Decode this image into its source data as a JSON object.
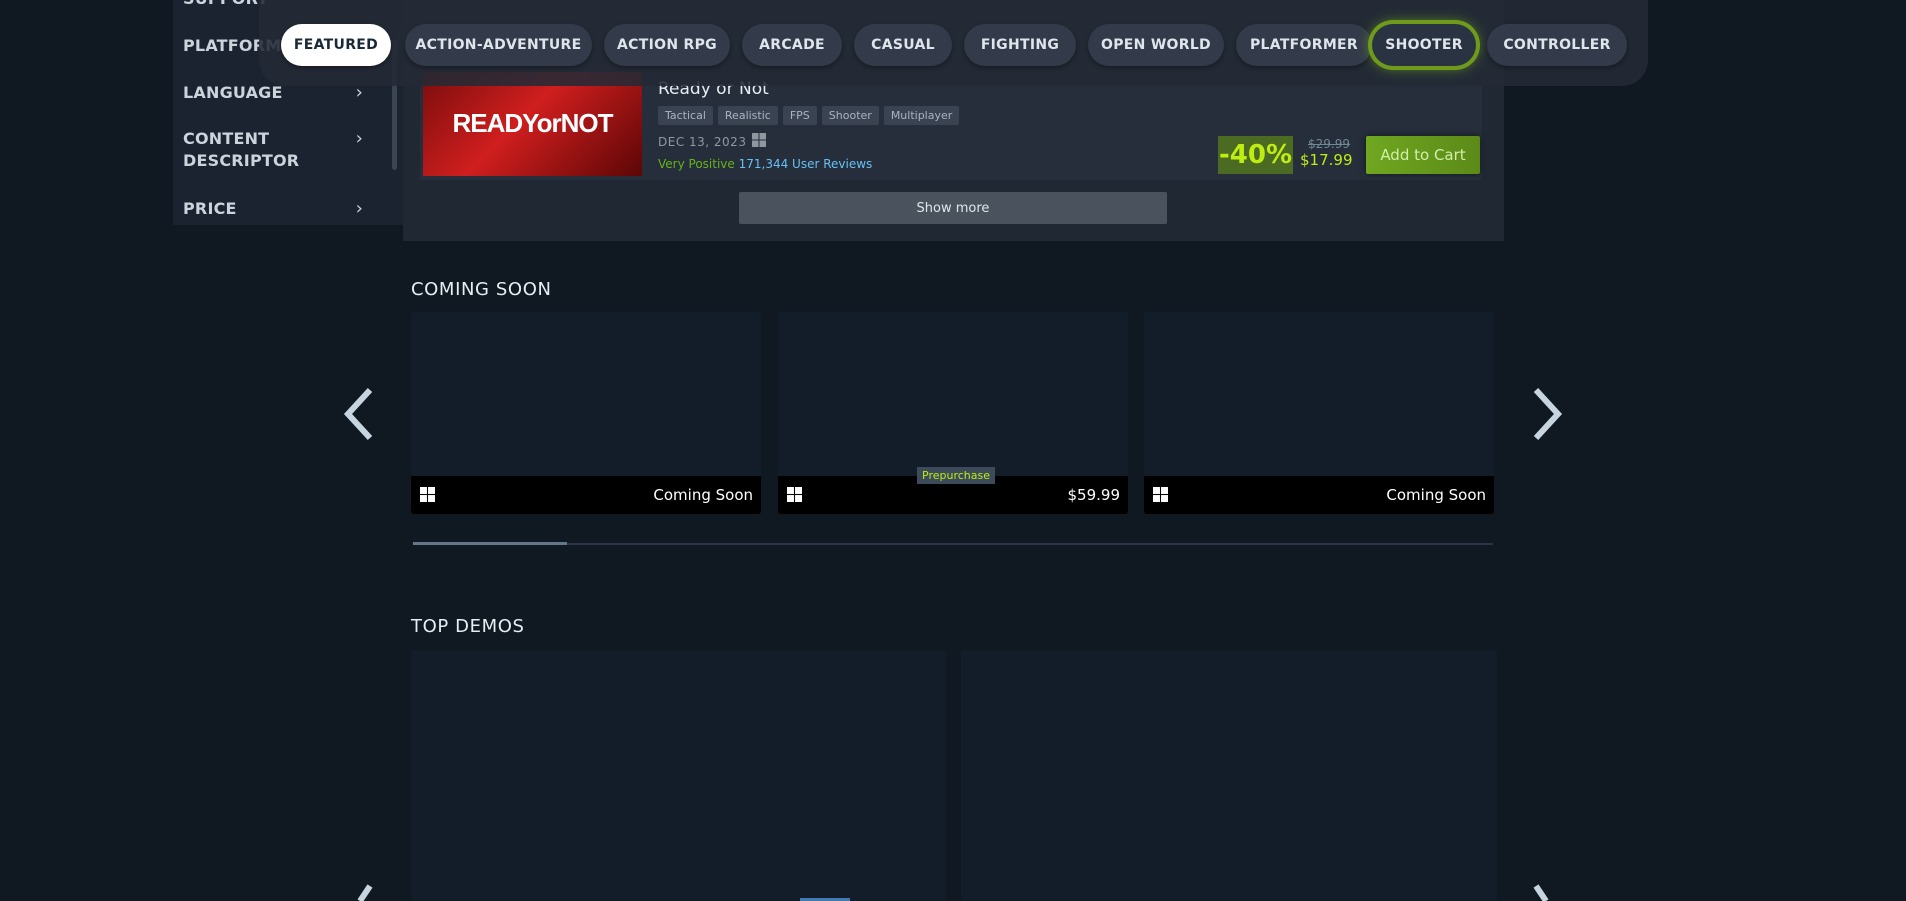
{
  "sidebar": {
    "items": [
      {
        "label": "SUPPORT"
      },
      {
        "label": "PLATFORM"
      },
      {
        "label": "LANGUAGE"
      },
      {
        "label": "CONTENT DESCRIPTOR"
      },
      {
        "label": "PRICE"
      }
    ]
  },
  "tagbar": {
    "tabs": [
      {
        "label": "FEATURED"
      },
      {
        "label": "ACTION-ADVENTURE"
      },
      {
        "label": "ACTION RPG"
      },
      {
        "label": "ARCADE"
      },
      {
        "label": "CASUAL"
      },
      {
        "label": "FIGHTING"
      },
      {
        "label": "OPEN WORLD"
      },
      {
        "label": "PLATFORMER"
      },
      {
        "label": "SHOOTER"
      },
      {
        "label": "CONTROLLER"
      }
    ],
    "active": "FEATURED",
    "highlighted": "SHOOTER",
    "highlight_color": "#7bb81c"
  },
  "game": {
    "title": "Ready or Not",
    "thumb_text": "READYorNOT",
    "tags": [
      "Tactical",
      "Realistic",
      "FPS",
      "Shooter",
      "Multiplayer"
    ],
    "release_date": "DEC 13, 2023",
    "review_summary": "Very Positive",
    "review_count": "171,344 User Reviews",
    "discount": "-40%",
    "original_price": "$29.99",
    "final_price": "$17.99",
    "cart_label": "Add to Cart",
    "platform_icon": "windows-icon"
  },
  "show_more_label": "Show more",
  "coming_soon": {
    "title": "COMING SOON",
    "cards": [
      {
        "price": "Coming Soon",
        "platform_icon": "windows-icon"
      },
      {
        "price": "$59.99",
        "badge": "Prepurchase",
        "platform_icon": "windows-icon"
      },
      {
        "price": "Coming Soon",
        "platform_icon": "windows-icon"
      }
    ]
  },
  "top_demos": {
    "title": "TOP DEMOS"
  },
  "colors": {
    "background": "#101822",
    "discount_text": "#beee11",
    "cart_button": "#6fa720",
    "review_positive": "#66b31a"
  }
}
